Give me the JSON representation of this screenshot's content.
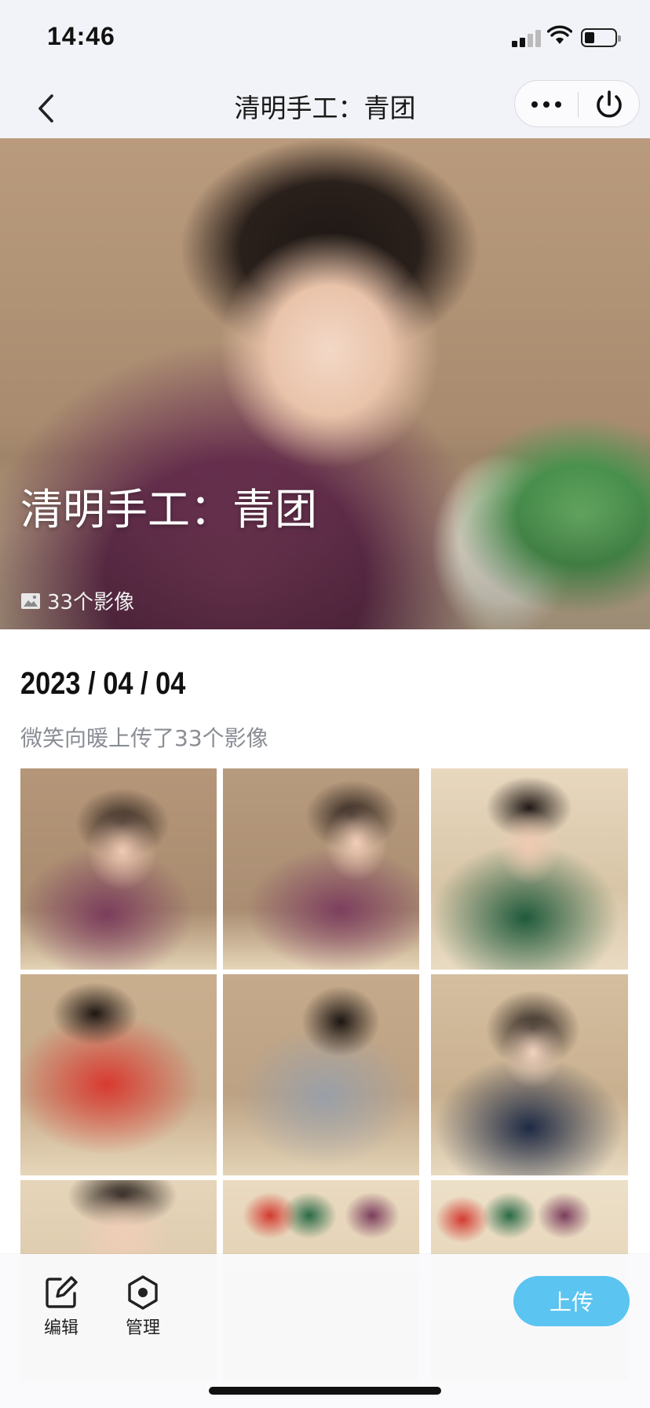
{
  "status_bar": {
    "time": "14:46"
  },
  "nav": {
    "title": "清明手工：青团"
  },
  "hero": {
    "title": "清明手工：青团",
    "media_count": "33个影像"
  },
  "album": {
    "date": "2023 / 04 / 04",
    "uploader_line": "微笑向暖上传了33个影像",
    "photo_count": 9
  },
  "toolbar": {
    "edit_label": "编辑",
    "manage_label": "管理",
    "upload_label": "上传"
  },
  "colors": {
    "accent": "#5bc4f0",
    "nav_bg": "#f2f3f8"
  }
}
